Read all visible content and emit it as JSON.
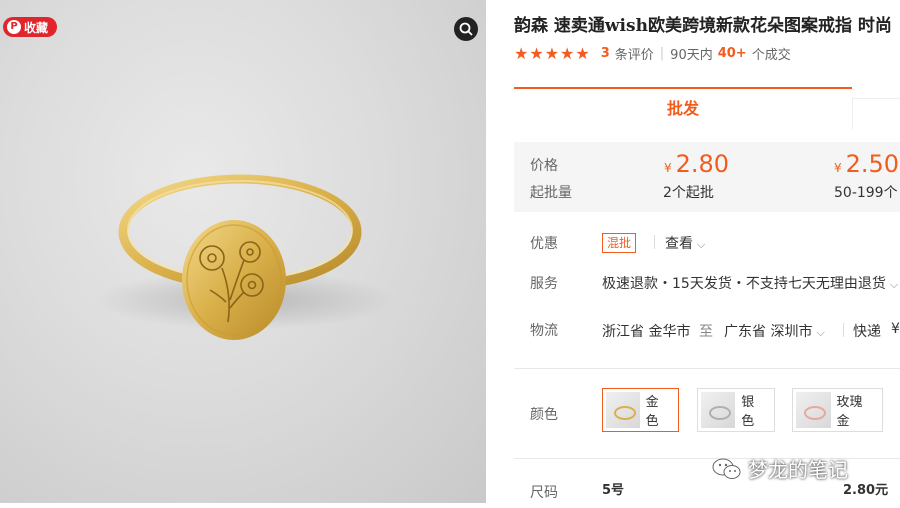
{
  "image": {
    "fav_label": "收藏",
    "fav_icon": "pinterest-icon",
    "zoom_icon": "zoom-icon"
  },
  "product": {
    "title": "韵森 速卖通wish欧美跨境新款花朵图案戒指 时尚"
  },
  "rating": {
    "stars": 5,
    "count": "3",
    "count_suffix": "条评价",
    "period": "90天内",
    "deals": "40+",
    "deals_suffix": "个成交"
  },
  "tabs": {
    "active": "批发"
  },
  "pricing": {
    "price_label": "价格",
    "qty_label": "起批量",
    "currency": "¥",
    "tiers": [
      {
        "price": "2.80",
        "qty": "2个起批"
      },
      {
        "price": "2.50",
        "qty": "50-199个"
      }
    ]
  },
  "promo": {
    "label": "优惠",
    "tag": "混批",
    "link": "查看"
  },
  "service": {
    "label": "服务",
    "text": "极速退款・15天发货・不支持七天无理由退货"
  },
  "logistics": {
    "label": "物流",
    "from": "浙江省 金华市",
    "to_word": "至",
    "to": "广东省 深圳市",
    "method": "快递",
    "fee_prefix": "¥"
  },
  "colors": {
    "label": "颜色",
    "options": [
      {
        "name": "金色",
        "selected": true
      },
      {
        "name": "银色",
        "selected": false
      },
      {
        "name": "玫瑰金",
        "selected": false
      }
    ]
  },
  "size": {
    "label": "尺码",
    "value": "5号",
    "price": "2.80元"
  },
  "watermark": {
    "text": "梦龙的笔记",
    "icon": "wechat-icon"
  },
  "theme": {
    "accent": "#f25c1f",
    "badge_red": "#e0262c"
  }
}
